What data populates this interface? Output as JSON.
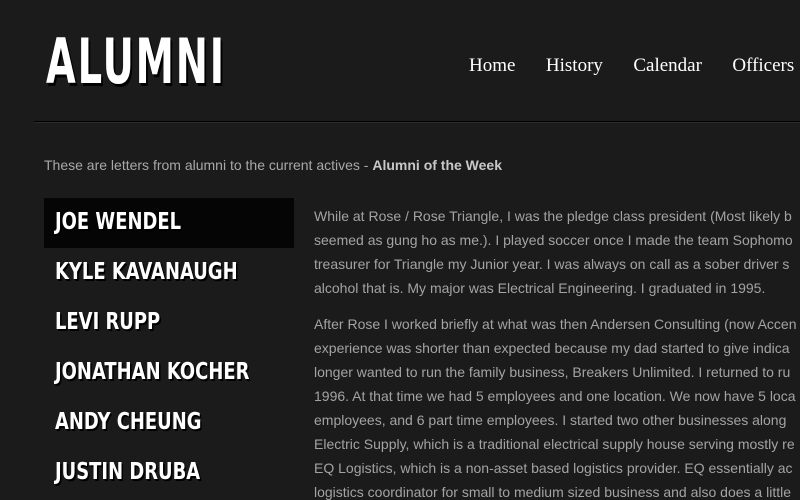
{
  "header": {
    "logo": "ALUMNI",
    "nav": [
      "Home",
      "History",
      "Calendar",
      "Officers"
    ]
  },
  "intro": {
    "text": "These are letters from alumni to the current actives - ",
    "link": "Alumni of the Week"
  },
  "alumni_list": [
    "JOE WENDEL",
    "KYLE KAVANAUGH",
    "LEVI RUPP",
    "JONATHAN KOCHER",
    "ANDY CHEUNG",
    "JUSTIN DRUBA"
  ],
  "letter": {
    "paragraph1": [
      "While at Rose / Rose Triangle, I was the pledge class president (Most likely b",
      "seemed as gung ho as me.). I played soccer once I made the team Sophomo",
      "treasurer for Triangle my Junior year. I was always on call as a sober driver s",
      "alcohol that is. My major was Electrical Engineering. I graduated in 1995."
    ],
    "paragraph2": [
      "After Rose I worked briefly at what was then Andersen Consulting (now Accen",
      "experience was shorter than expected because my dad started to give indica",
      "longer wanted to run the family business, Breakers Unlimited. I returned to ru",
      "1996. At that time we had 5 employees and one location. We now have 5 loca",
      "employees, and 6 part time employees. I started two other businesses along",
      "Electric Supply, which is a traditional electrical supply house serving mostly re",
      "EQ Logistics, which is a non-asset based logistics provider. EQ essentially ac",
      "logistics coordinator for small to medium sized business and also does a little"
    ]
  }
}
